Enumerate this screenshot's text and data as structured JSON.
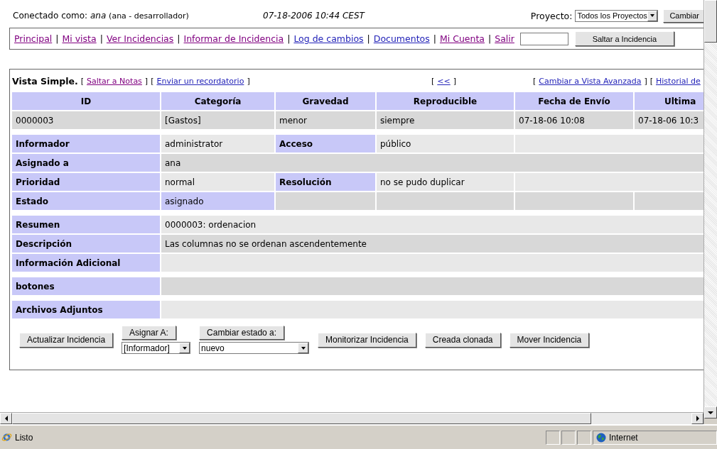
{
  "header": {
    "user": "Conectado como: *ana*",
    "role": "(ana - desarrollador)",
    "datetime": "07-18-2006 10:44 CEST",
    "project": {
      "label": "Proyecto:",
      "value": "Todos los Proyectos",
      "button": "Cambiar"
    }
  },
  "nav": {
    "separator": "|",
    "links": [
      {
        "label": "Principal",
        "visited": true
      },
      {
        "label": "Mi vista",
        "visited": true
      },
      {
        "label": "Ver Incidencias",
        "visited": true
      },
      {
        "label": "Informar de Incidencia",
        "visited": true
      },
      {
        "label": "Log de cambios",
        "visited": false
      },
      {
        "label": "Documentos",
        "visited": false
      },
      {
        "label": "Mi Cuenta",
        "visited": true
      },
      {
        "label": "Salir",
        "visited": true
      }
    ],
    "jump_button": "Saltar a Incidencia"
  },
  "view": {
    "title": "Vista Simple.",
    "left_links": [
      {
        "open": "[",
        "label": "Saltar a Notas",
        "close": "]",
        "visited": true
      },
      {
        "open": "[",
        "label": "Enviar un recordatorio",
        "close": "]",
        "visited": false
      }
    ],
    "center_links": [
      {
        "open": "[",
        "label": "<<",
        "close": "]",
        "visited": false
      }
    ],
    "right_links": [
      {
        "open": "[",
        "label": "Cambiar a Vista Avanzada",
        "close": "]",
        "visited": false
      },
      {
        "open": "[",
        "label": "Historial de",
        "visited": false
      }
    ]
  },
  "table": {
    "columns": [
      "ID",
      "Categoría",
      "Gravedad",
      "Reproducible",
      "Fecha de Envío",
      "Ultima"
    ],
    "row": [
      "0000003",
      "[Gastos]",
      "menor",
      "siempre",
      "07-18-06 10:08",
      "07-18-06 10:3"
    ]
  },
  "details": [
    {
      "rows": [
        [
          {
            "kind": "label",
            "text": "Informador"
          },
          {
            "kind": "value",
            "text": "administrator"
          },
          {
            "kind": "label",
            "text": "Acceso"
          },
          {
            "kind": "value",
            "text": "público"
          },
          {
            "kind": "empty"
          }
        ],
        [
          {
            "kind": "label",
            "text": "Asignado a"
          },
          {
            "kind": "value",
            "text": "ana"
          }
        ],
        [
          {
            "kind": "label",
            "text": "Prioridad"
          },
          {
            "kind": "value",
            "text": "normal"
          },
          {
            "kind": "label",
            "text": "Resolución"
          },
          {
            "kind": "value",
            "text": "no se pudo duplicar"
          },
          {
            "kind": "empty"
          }
        ],
        [
          {
            "kind": "label",
            "text": "Estado"
          },
          {
            "kind": "highlight",
            "text": "asignado"
          },
          {
            "kind": "empty"
          },
          {
            "kind": "empty"
          },
          {
            "kind": "empty"
          },
          {
            "kind": "empty"
          }
        ]
      ]
    },
    {
      "rows": [
        [
          {
            "kind": "label",
            "text": "Resumen"
          },
          {
            "kind": "value",
            "text": "0000003: ordenacion"
          }
        ],
        [
          {
            "kind": "label",
            "text": "Descripción"
          },
          {
            "kind": "value",
            "text": "Las columnas no se ordenan ascendentemente"
          }
        ],
        [
          {
            "kind": "label",
            "text": "Información Adicional"
          },
          {
            "kind": "empty"
          }
        ]
      ]
    },
    {
      "rows": [
        [
          {
            "kind": "label",
            "text": "botones"
          },
          {
            "kind": "empty"
          }
        ]
      ]
    },
    {
      "rows": [
        [
          {
            "kind": "label",
            "text": "Archivos Adjuntos"
          },
          {
            "kind": "empty"
          }
        ]
      ]
    }
  ],
  "actions": [
    {
      "kind": "button",
      "label": "Actualizar Incidencia"
    },
    {
      "kind": "select",
      "label": "Asignar A:",
      "value": "[Informador]"
    },
    {
      "kind": "select",
      "label": "Cambiar estado a:",
      "value": "nuevo"
    },
    {
      "kind": "button",
      "label": "Monitorizar Incidencia"
    },
    {
      "kind": "button",
      "label": "Creada clonada"
    },
    {
      "kind": "button",
      "label": "Mover Incidencia"
    }
  ],
  "status": {
    "text": "Listo",
    "zone": "Internet"
  }
}
